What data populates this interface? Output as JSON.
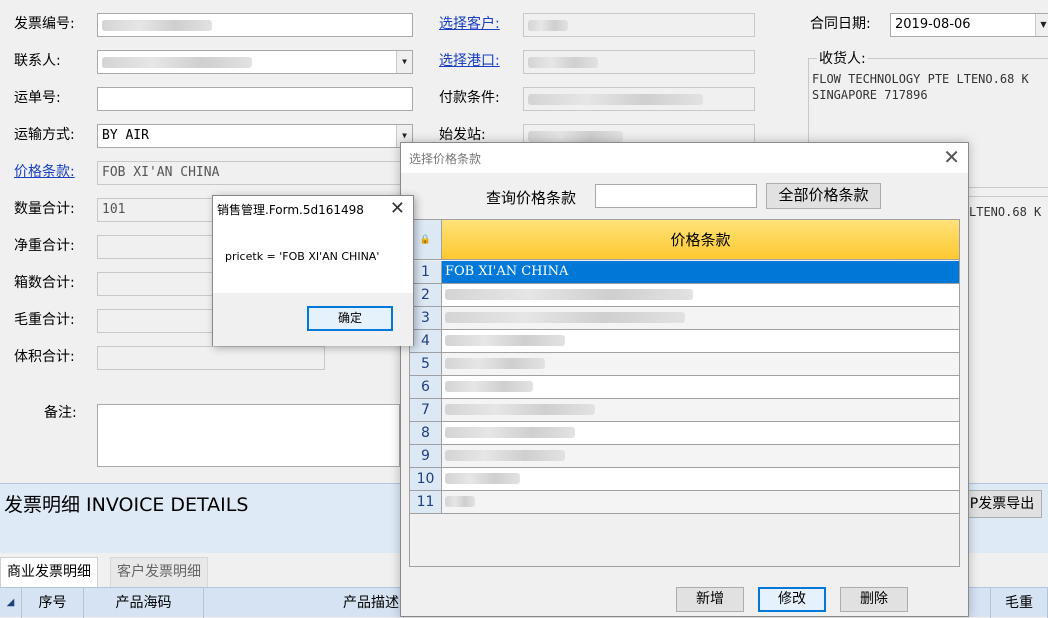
{
  "form": {
    "invoice_no_label": "发票编号:",
    "contact_label": "联系人:",
    "waybill_label": "运单号:",
    "transport_label": "运输方式:",
    "transport_value": "BY AIR",
    "price_terms_label": "价格条款:",
    "price_terms_value": "FOB XI'AN CHINA",
    "qty_total_label": "数量合计:",
    "qty_total_value": "101",
    "net_weight_label": "净重合计:",
    "box_count_label": "箱数合计:",
    "gross_weight_label": "毛重合计:",
    "volume_label": "体积合计:",
    "remarks_label": "备注:",
    "select_customer_label": "选择客户:",
    "select_port_label": "选择港口:",
    "payment_terms_label": "付款条件:",
    "origin_label": "始发站:",
    "contract_date_label": "合同日期:",
    "contract_date_value": "2019-08-06",
    "consignee_label": "收货人:",
    "consignee_line1": "FLOW TECHNOLOGY PTE LTENO.68 K",
    "consignee_line2": "SINGAPORE 717896",
    "consignee_extra": "LTENO.68 K"
  },
  "invoice_details": {
    "title": "发票明细 INVOICE DETAILS",
    "export_button": "P发票导出",
    "tabs": [
      "商业发票明细",
      "客户发票明细"
    ],
    "columns": [
      "序号",
      "产品海码",
      "产品描述",
      "毛重"
    ]
  },
  "price_dialog": {
    "title": "选择价格条款",
    "query_label": "查询价格条款",
    "all_button": "全部价格条款",
    "column_header": "价格条款",
    "rows": [
      {
        "num": "1",
        "value": "FOB XI'AN CHINA",
        "selected": true
      },
      {
        "num": "2",
        "value": ""
      },
      {
        "num": "3",
        "value": ""
      },
      {
        "num": "4",
        "value": ""
      },
      {
        "num": "5",
        "value": ""
      },
      {
        "num": "6",
        "value": ""
      },
      {
        "num": "7",
        "value": ""
      },
      {
        "num": "8",
        "value": ""
      },
      {
        "num": "9",
        "value": ""
      },
      {
        "num": "10",
        "value": ""
      },
      {
        "num": "11",
        "value": ""
      }
    ],
    "add_button": "新增",
    "edit_button": "修改",
    "delete_button": "删除"
  },
  "message_box": {
    "title": "销售管理.Form.5d161498",
    "message": "pricetk = 'FOB XI'AN CHINA'",
    "ok_button": "确定"
  },
  "colors": {
    "link": "#1a3fbf",
    "header_yellow": "#fdd34c",
    "selection_blue": "#0078d7",
    "band_blue": "#dfeaf7"
  }
}
